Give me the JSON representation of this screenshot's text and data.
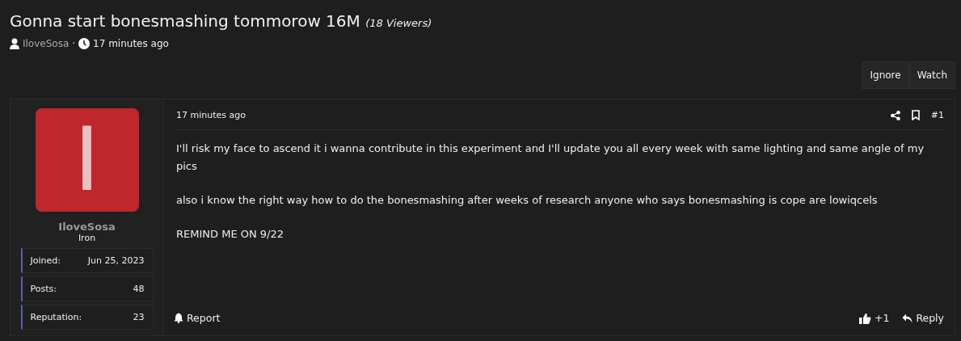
{
  "thread": {
    "title": "Gonna start bonesmashing tommorow 16M",
    "viewers": "(18 Viewers)",
    "author": "IloveSosa",
    "separator": "·",
    "time": "17 minutes ago"
  },
  "actions": [
    "Ignore",
    "Watch"
  ],
  "post": {
    "avatar_letter": "I",
    "username": "IloveSosa",
    "rank": "Iron",
    "stats": [
      {
        "label": "Joined:",
        "value": "Jun 25, 2023"
      },
      {
        "label": "Posts:",
        "value": "48"
      },
      {
        "label": "Reputation:",
        "value": "23"
      }
    ],
    "time": "17 minutes ago",
    "number": "#1",
    "paragraphs": [
      "I'll risk my face to ascend it i wanna contribute in this experiment and I'll update you all every week with same lighting and same angle of my pics",
      "also i know the right way how to do the bonesmashing after weeks of research anyone who says bonesmashing is cope are lowiqcels",
      "REMIND ME ON 9/22"
    ],
    "report": "Report",
    "likes": "+1",
    "reply": "Reply"
  }
}
